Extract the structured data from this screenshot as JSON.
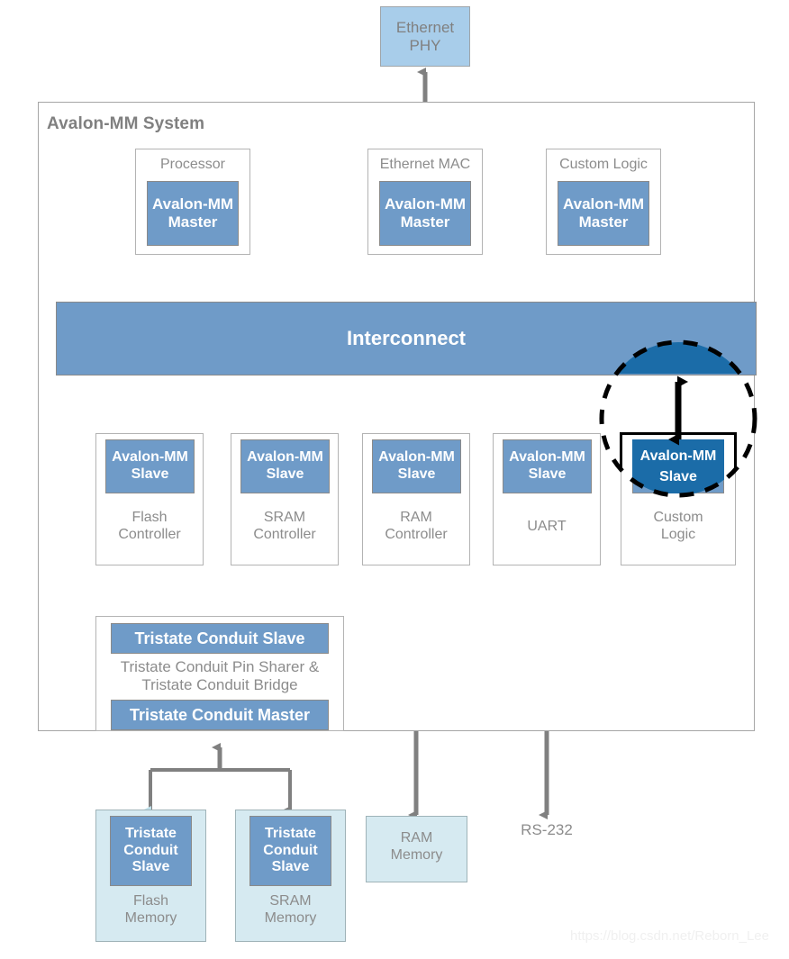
{
  "diagram": {
    "title": "Avalon-MM System",
    "watermark": "https://blog.csdn.net/Reborn_Lee",
    "colors": {
      "port_blue": "#6f9bc8",
      "highlight_blue": "#1b6ca8",
      "phy_blue": "#a8cdea",
      "memory_cyan": "#d6eaf1",
      "arrow_gray": "#808080",
      "label_gray": "#8c8c8c",
      "border_gray": "#b3b3b3"
    }
  },
  "external_top": {
    "ethernet_phy": "Ethernet\nPHY"
  },
  "masters": [
    {
      "name": "Processor",
      "port": "Avalon-MM\nMaster"
    },
    {
      "name": "Ethernet MAC",
      "port": "Avalon-MM\nMaster"
    },
    {
      "name": "Custom Logic",
      "port": "Avalon-MM\nMaster"
    }
  ],
  "interconnect": {
    "label": "Interconnect"
  },
  "slaves": [
    {
      "name": "Flash\nController",
      "port": "Avalon-MM\nSlave",
      "highlighted": false
    },
    {
      "name": "SRAM\nController",
      "port": "Avalon-MM\nSlave",
      "highlighted": false
    },
    {
      "name": "RAM\nController",
      "port": "Avalon-MM\nSlave",
      "highlighted": false
    },
    {
      "name": "UART",
      "port": "Avalon-MM\nSlave",
      "highlighted": false
    },
    {
      "name": "Custom\nLogic",
      "port": "Avalon-MM\nSlave",
      "highlighted": true
    }
  ],
  "bridge": {
    "slave_port": "Tristate Conduit Slave",
    "name": "Tristate Conduit Pin Sharer &\nTristate Conduit Bridge",
    "master_port": "Tristate Conduit Master"
  },
  "memories": [
    {
      "name": "Flash\nMemory",
      "port": "Tristate\nConduit\nSlave"
    },
    {
      "name": "SRAM\nMemory",
      "port": "Tristate\nConduit\nSlave"
    },
    {
      "name": "RAM\nMemory",
      "port": null
    }
  ],
  "external_bottom": {
    "rs232": "RS-232"
  }
}
